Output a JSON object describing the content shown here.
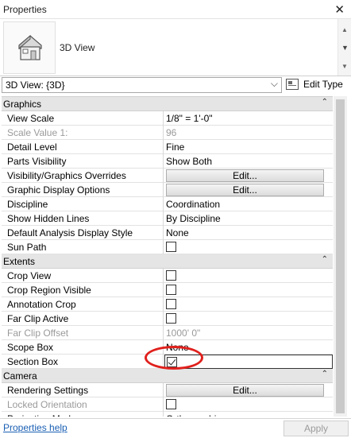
{
  "panel": {
    "title": "Properties",
    "close_icon": "close-icon"
  },
  "type_selector": {
    "icon": "house-3d-icon",
    "name": "3D View"
  },
  "instance_selector": {
    "value": "3D View: {3D}"
  },
  "edit_type": {
    "label": "Edit Type"
  },
  "properties": [
    {
      "kind": "group",
      "name": "Graphics"
    },
    {
      "kind": "row",
      "label": "View Scale",
      "value": "1/8\" = 1'-0\"",
      "disabled": false
    },
    {
      "kind": "row",
      "label": "Scale Value    1:",
      "value": "96",
      "disabled": true
    },
    {
      "kind": "row",
      "label": "Detail Level",
      "value": "Fine",
      "disabled": false
    },
    {
      "kind": "row",
      "label": "Parts Visibility",
      "value": "Show Both",
      "disabled": false
    },
    {
      "kind": "button",
      "label": "Visibility/Graphics Overrides",
      "value": "Edit..."
    },
    {
      "kind": "button",
      "label": "Graphic Display Options",
      "value": "Edit..."
    },
    {
      "kind": "row",
      "label": "Discipline",
      "value": "Coordination",
      "disabled": false
    },
    {
      "kind": "row",
      "label": "Show Hidden Lines",
      "value": "By Discipline",
      "disabled": false
    },
    {
      "kind": "row",
      "label": "Default Analysis Display Style",
      "value": "None",
      "disabled": false
    },
    {
      "kind": "check",
      "label": "Sun Path",
      "checked": false,
      "disabled": false
    },
    {
      "kind": "group",
      "name": "Extents"
    },
    {
      "kind": "check",
      "label": "Crop View",
      "checked": false,
      "disabled": false
    },
    {
      "kind": "check",
      "label": "Crop Region Visible",
      "checked": false,
      "disabled": false
    },
    {
      "kind": "check",
      "label": "Annotation Crop",
      "checked": false,
      "disabled": false
    },
    {
      "kind": "check",
      "label": "Far Clip Active",
      "checked": false,
      "disabled": false
    },
    {
      "kind": "row",
      "label": "Far Clip Offset",
      "value": "1000'  0\"",
      "disabled": true
    },
    {
      "kind": "row",
      "label": "Scope Box",
      "value": "None",
      "disabled": false
    },
    {
      "kind": "check",
      "label": "Section Box",
      "checked": true,
      "disabled": false,
      "boxed": true
    },
    {
      "kind": "group",
      "name": "Camera"
    },
    {
      "kind": "button",
      "label": "Rendering Settings",
      "value": "Edit..."
    },
    {
      "kind": "check",
      "label": "Locked Orientation",
      "checked": false,
      "disabled": true
    },
    {
      "kind": "row",
      "label": "Projection Mode",
      "value": "Orthographic",
      "disabled": false
    }
  ],
  "footer": {
    "help_link": "Properties help",
    "apply_label": "Apply"
  },
  "colors": {
    "highlight": "#e0201c",
    "link": "#1a5fb4",
    "group_bg": "#e5e5e5"
  }
}
